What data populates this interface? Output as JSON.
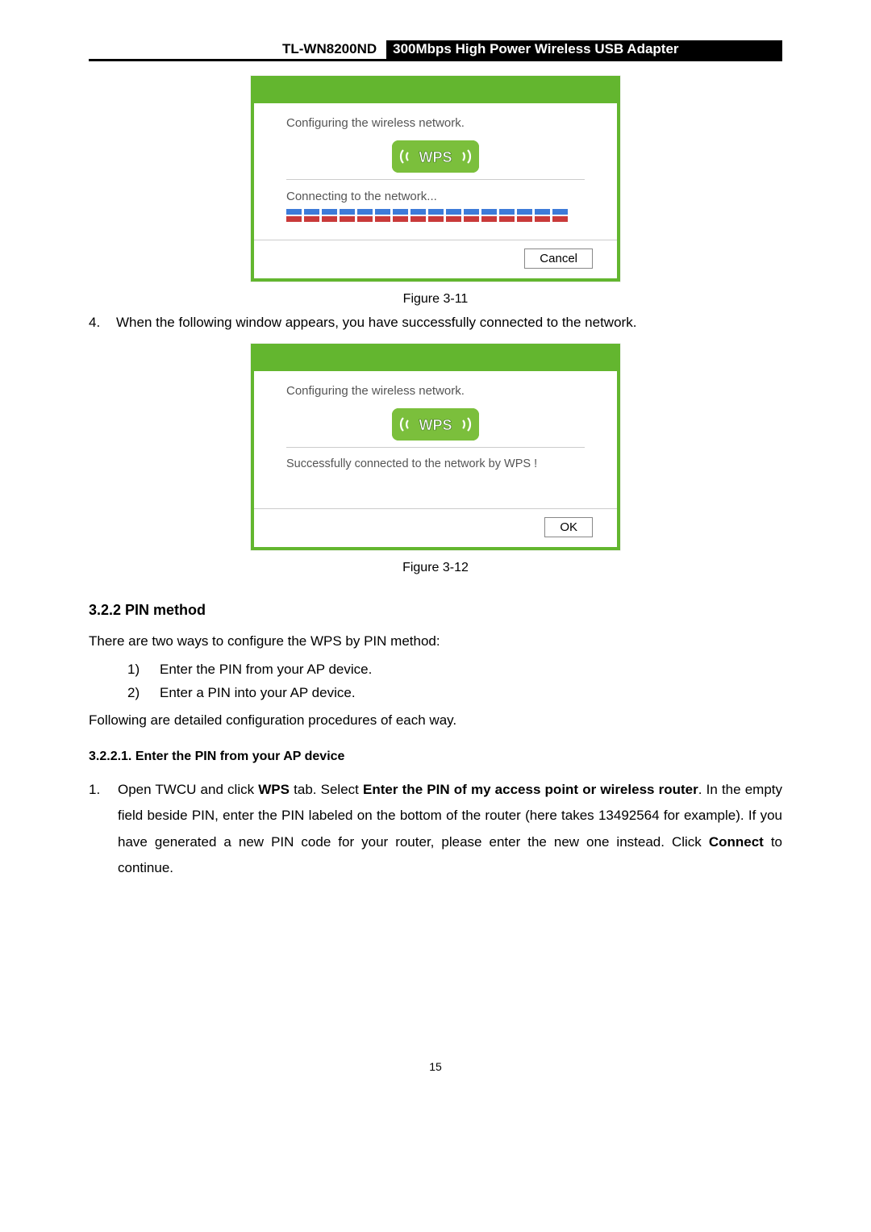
{
  "header": {
    "model": "TL-WN8200ND",
    "title": "300Mbps High Power Wireless USB Adapter"
  },
  "dialog1": {
    "msg1": "Configuring the wireless network.",
    "wps_label": "WPS",
    "msg2": "Connecting to the network...",
    "cancel": "Cancel"
  },
  "caption1": "Figure 3-11",
  "step4": {
    "num": "4.",
    "text": "When the following window appears, you have successfully connected to the network."
  },
  "dialog2": {
    "msg1": "Configuring the wireless network.",
    "wps_label": "WPS",
    "msg2": "Successfully connected to the network by WPS !",
    "ok": "OK"
  },
  "caption2": "Figure 3-12",
  "section322": {
    "heading": "3.2.2  PIN method",
    "intro": "There are two ways to configure the WPS by PIN method:",
    "items": [
      {
        "lbl": "1)",
        "txt": "Enter the PIN from your AP device."
      },
      {
        "lbl": "2)",
        "txt": "Enter a PIN into your AP device."
      }
    ],
    "outro": "Following are detailed configuration procedures of each way."
  },
  "section3221": {
    "heading": "3.2.2.1.  Enter the PIN from your AP device",
    "step1": {
      "num": "1.",
      "parts": {
        "a": "Open TWCU and click ",
        "b": "WPS",
        "c": " tab. Select ",
        "d": "Enter the PIN of my access point or wireless router",
        "e": ". In the empty field beside PIN, enter the PIN labeled on the bottom of the router (here takes 13492564 for example). If you have generated a new PIN code for your router, please enter the new one instead. Click ",
        "f": "Connect",
        "g": " to continue."
      }
    }
  },
  "page_number": "15"
}
